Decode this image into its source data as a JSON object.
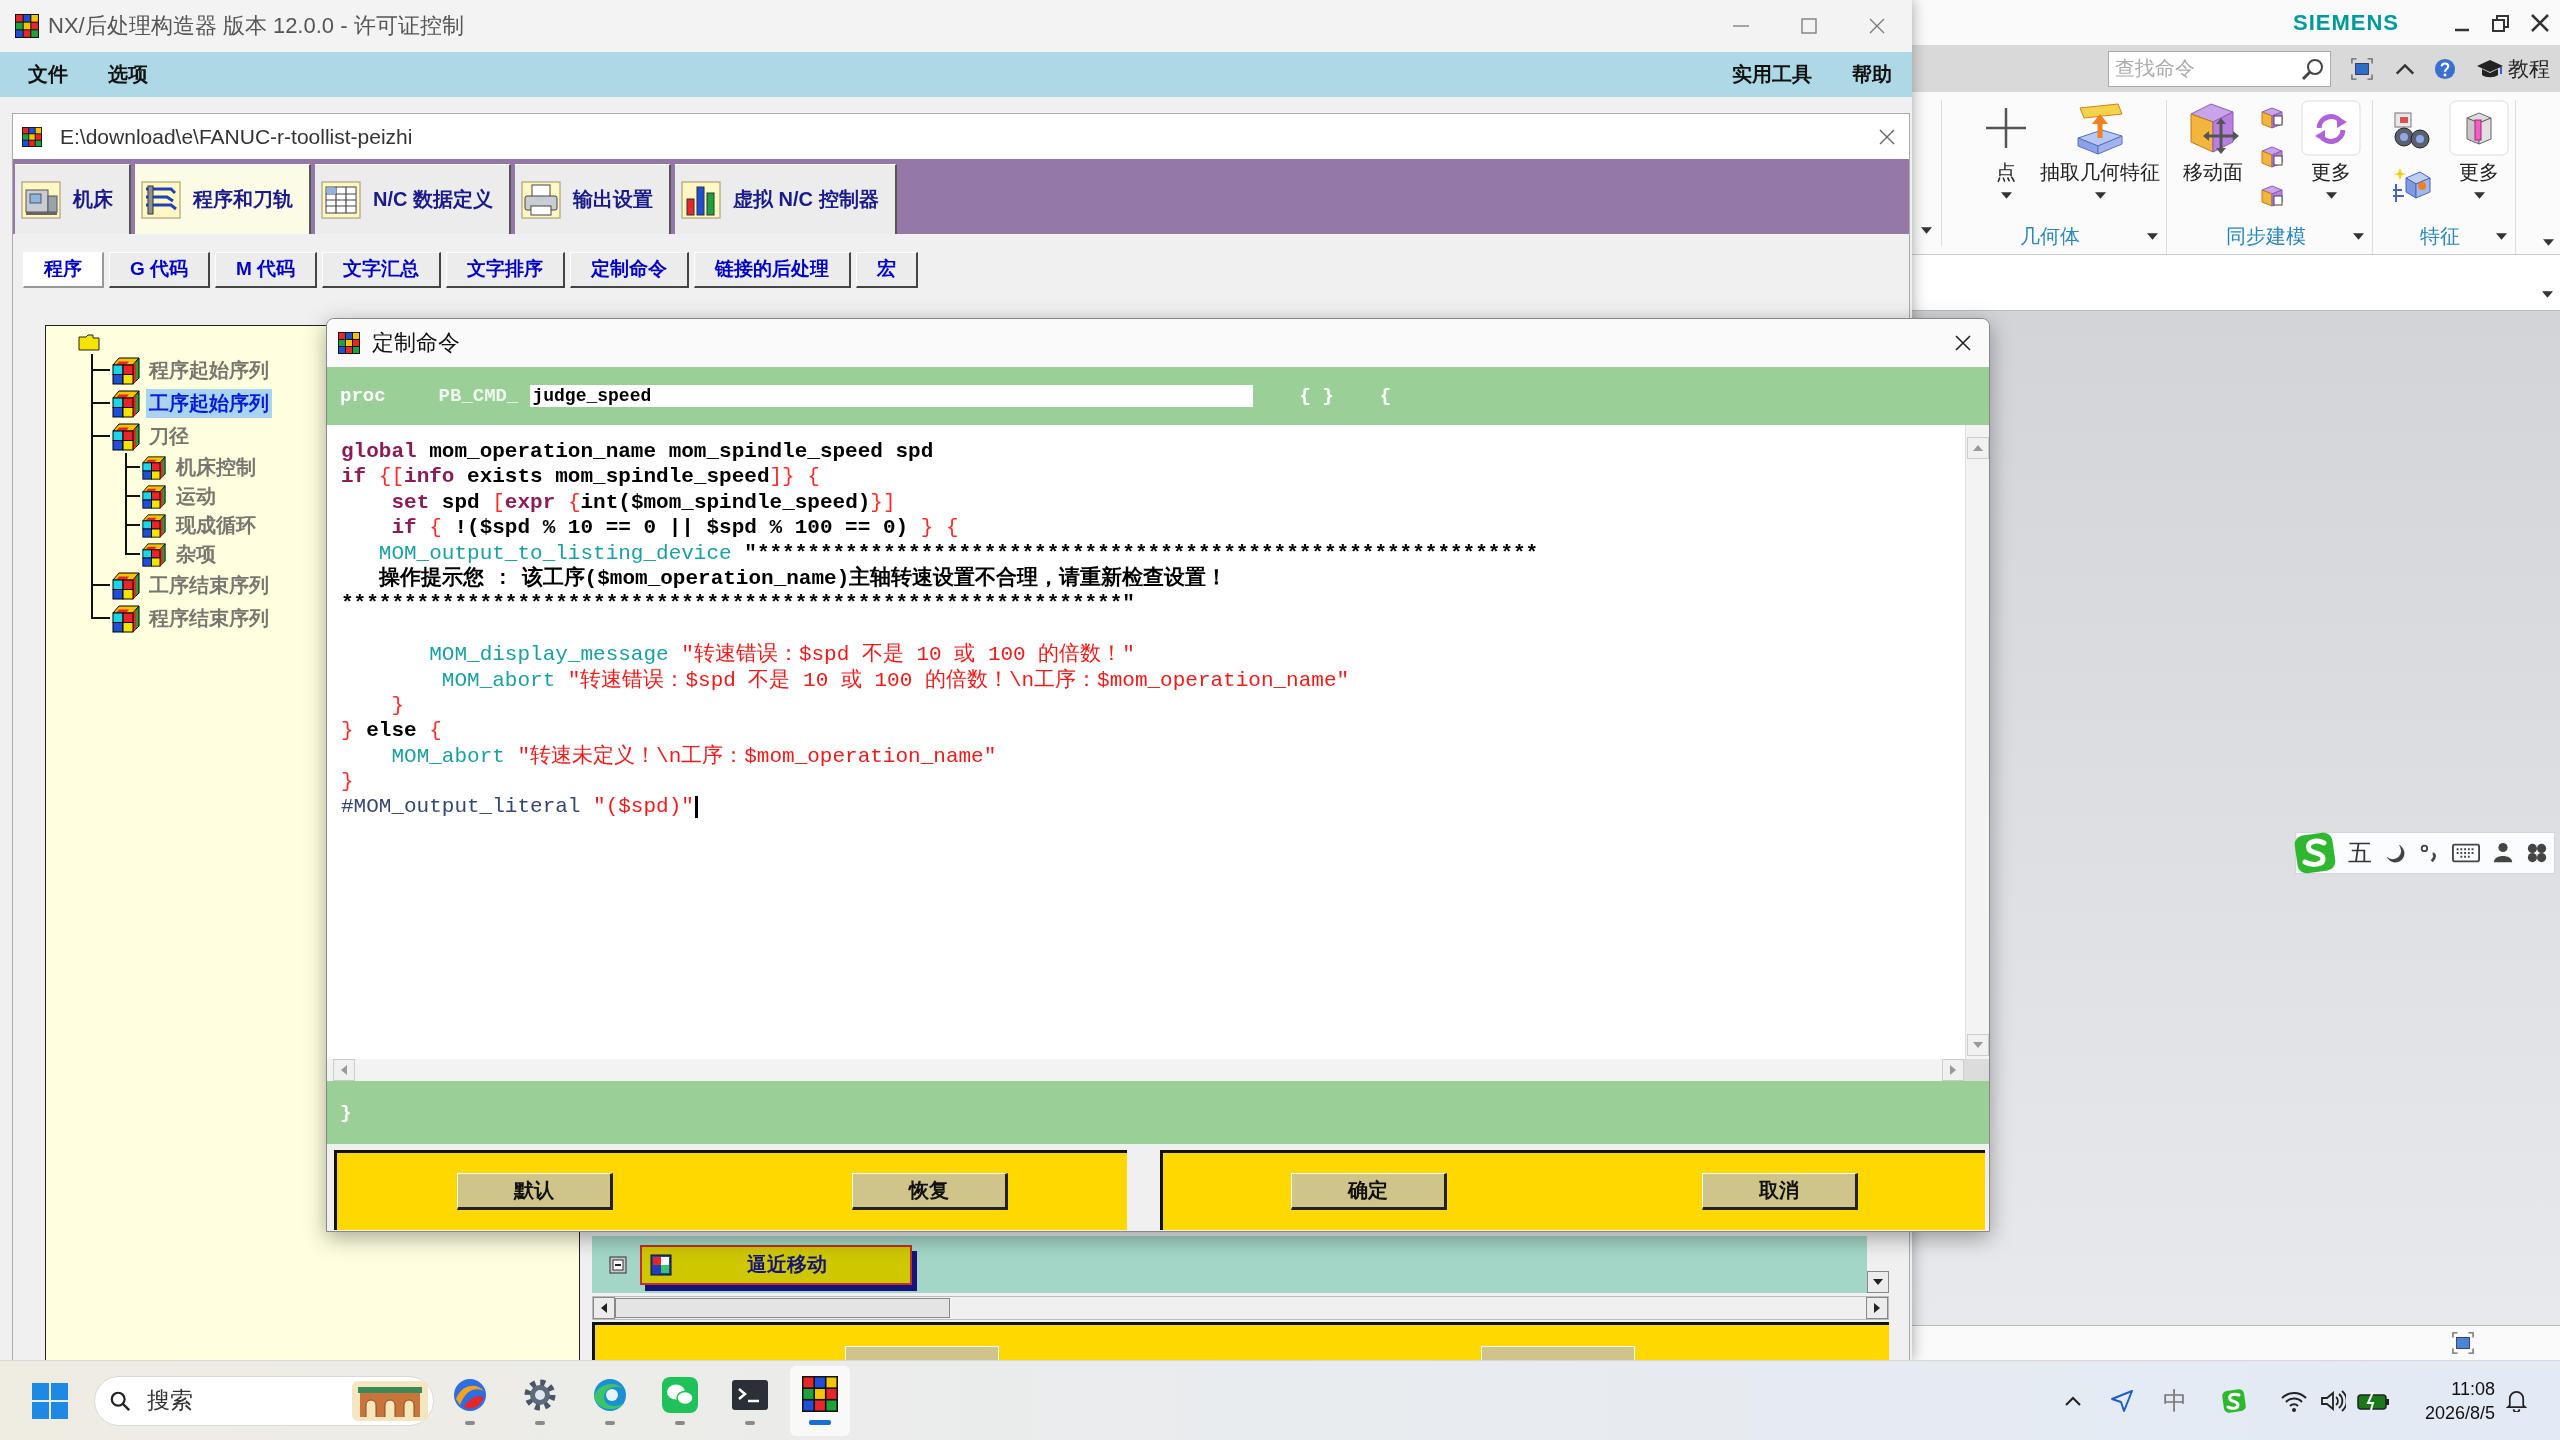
{
  "window": {
    "title": "NX/后处理构造器 版本 12.0.0 - 许可证控制"
  },
  "menu": {
    "left": [
      "文件",
      "选项"
    ],
    "right": [
      "实用工具",
      "帮助"
    ]
  },
  "document": {
    "title": "E:\\download\\e\\FANUC-r-toollist-peizhi"
  },
  "tabs": [
    {
      "label": "机床",
      "selected": false
    },
    {
      "label": "程序和刀轨",
      "selected": true
    },
    {
      "label": "N/C 数据定义",
      "selected": false
    },
    {
      "label": "输出设置",
      "selected": false
    },
    {
      "label": "虚拟 N/C 控制器",
      "selected": false
    }
  ],
  "subtabs": [
    {
      "label": "程序",
      "selected": true
    },
    {
      "label": "G 代码",
      "selected": false
    },
    {
      "label": "M 代码",
      "selected": false
    },
    {
      "label": "文字汇总",
      "selected": false
    },
    {
      "label": "文字排序",
      "selected": false
    },
    {
      "label": "定制命令",
      "selected": false
    },
    {
      "label": "链接的后处理",
      "selected": false
    },
    {
      "label": "宏",
      "selected": false
    }
  ],
  "tree": {
    "children": [
      {
        "label": "程序起始序列",
        "selected": false,
        "disabled": true
      },
      {
        "label": "工序起始序列",
        "selected": true,
        "disabled": false
      },
      {
        "label": "刀径",
        "selected": false,
        "disabled": true,
        "children": [
          {
            "label": "机床控制",
            "selected": false,
            "disabled": true
          },
          {
            "label": "运动",
            "selected": false,
            "disabled": true
          },
          {
            "label": "现成循环",
            "selected": false,
            "disabled": true
          },
          {
            "label": "杂项",
            "selected": false,
            "disabled": true
          }
        ]
      },
      {
        "label": "工序结束序列",
        "selected": false,
        "disabled": true
      },
      {
        "label": "程序结束序列",
        "selected": false,
        "disabled": true
      }
    ]
  },
  "event_panel": {
    "button": "逼近移动"
  },
  "dialog": {
    "title": "定制命令",
    "proc": "proc",
    "prefix": "PB_CMD_",
    "name": "judge_speed",
    "args": "{ }",
    "open_brace": "{",
    "code_lines": [
      {
        "kind": "code",
        "tokens": [
          {
            "kind": "keyword",
            "text": "global"
          },
          {
            "kind": "plain",
            "text": " mom_operation_name mom_spindle_speed spd"
          }
        ]
      },
      {
        "kind": "code",
        "tokens": [
          {
            "kind": "keyword",
            "text": "if "
          },
          {
            "kind": "bracket",
            "text": "{["
          },
          {
            "kind": "keyword",
            "text": "info"
          },
          {
            "kind": "plain",
            "text": " exists mom_spindle_speed"
          },
          {
            "kind": "bracket",
            "text": "]} {"
          }
        ]
      },
      {
        "kind": "code",
        "tokens": [
          {
            "kind": "keyword",
            "text": "    set"
          },
          {
            "kind": "plain",
            "text": " spd "
          },
          {
            "kind": "bracket",
            "text": "["
          },
          {
            "kind": "keyword",
            "text": "expr"
          },
          {
            "kind": "bracket",
            "text": " {"
          },
          {
            "kind": "plain",
            "text": "int($mom_spindle_speed)"
          },
          {
            "kind": "bracket",
            "text": "}]"
          }
        ]
      },
      {
        "kind": "code",
        "tokens": [
          {
            "kind": "keyword",
            "text": "    if "
          },
          {
            "kind": "bracket",
            "text": "{"
          },
          {
            "kind": "plain",
            "text": " !($spd % 10 == 0 || $spd % 100 == 0) "
          },
          {
            "kind": "bracket",
            "text": "} {"
          }
        ]
      },
      {
        "kind": "code",
        "tokens": [
          {
            "kind": "command",
            "text": "   MOM_output_to_listing_device"
          },
          {
            "kind": "plain",
            "text": " \"**************************************************************"
          }
        ]
      },
      {
        "kind": "code",
        "tokens": [
          {
            "kind": "plain",
            "text": "   操作提示您 : 该工序($mom_operation_name)主轴转速设置不合理，请重新检查设置！"
          }
        ]
      },
      {
        "kind": "code",
        "tokens": [
          {
            "kind": "plain",
            "text": "**************************************************************\""
          }
        ]
      },
      {
        "kind": "blank"
      },
      {
        "kind": "code",
        "tokens": [
          {
            "kind": "command",
            "text": "       MOM_display_message"
          },
          {
            "kind": "string",
            "text": " \"转速错误：$spd 不是 10 或 100 的倍数！\""
          }
        ]
      },
      {
        "kind": "code",
        "tokens": [
          {
            "kind": "command",
            "text": "        MOM_abort"
          },
          {
            "kind": "string",
            "text": " \"转速错误：$spd 不是 10 或 100 的倍数！\\n工序：$mom_operation_name\""
          }
        ]
      },
      {
        "kind": "code",
        "tokens": [
          {
            "kind": "bracket",
            "text": "    }"
          }
        ]
      },
      {
        "kind": "code",
        "tokens": [
          {
            "kind": "bracket",
            "text": "}"
          },
          {
            "kind": "plain",
            "text": " else "
          },
          {
            "kind": "bracket",
            "text": "{"
          }
        ]
      },
      {
        "kind": "code",
        "tokens": [
          {
            "kind": "command",
            "text": "    MOM_abort"
          },
          {
            "kind": "string",
            "text": " \"转速未定义！\\n工序：$mom_operation_name\""
          }
        ]
      },
      {
        "kind": "code",
        "tokens": [
          {
            "kind": "bracket",
            "text": "}"
          }
        ]
      },
      {
        "kind": "code",
        "tokens": [
          {
            "kind": "comment",
            "text": "#MOM_output_literal "
          },
          {
            "kind": "string",
            "text": "\"($spd)\""
          },
          {
            "kind": "caret"
          }
        ]
      }
    ],
    "close_brace": "}",
    "button_groups": [
      [
        "默认",
        "恢复"
      ],
      [
        "确定",
        "取消"
      ]
    ]
  },
  "nx_window": {
    "brand": "SIEMENS",
    "search": {
      "placeholder": "查找命令"
    },
    "tutorial": "教程",
    "ribbon_groups": [
      {
        "label": "几何体",
        "items": [
          {
            "kind": "point",
            "label": "点"
          },
          {
            "kind": "extract",
            "label": "抽取几何特征"
          }
        ]
      },
      {
        "label": "同步建模",
        "items": [
          {
            "kind": "moveface",
            "label": "移动面"
          },
          {
            "kind": "trio"
          },
          {
            "kind": "cycle",
            "label": "更多"
          }
        ]
      },
      {
        "label": "特征",
        "items": [
          {
            "kind": "duo"
          },
          {
            "kind": "pillar",
            "label": "更多"
          }
        ]
      }
    ]
  },
  "ime_toolbar": {
    "mode": "五"
  },
  "taskbar": {
    "search": {
      "placeholder": "搜索"
    },
    "apps": [
      {
        "kind": "design",
        "selected": false
      },
      {
        "kind": "settings",
        "selected": false
      },
      {
        "kind": "browser",
        "selected": false
      },
      {
        "kind": "chat",
        "selected": false
      },
      {
        "kind": "terminal",
        "selected": false
      },
      {
        "kind": "postbuilder",
        "selected": true
      }
    ],
    "tray": {
      "language": "中",
      "time": "11:08",
      "date": "2026/8/5"
    }
  }
}
